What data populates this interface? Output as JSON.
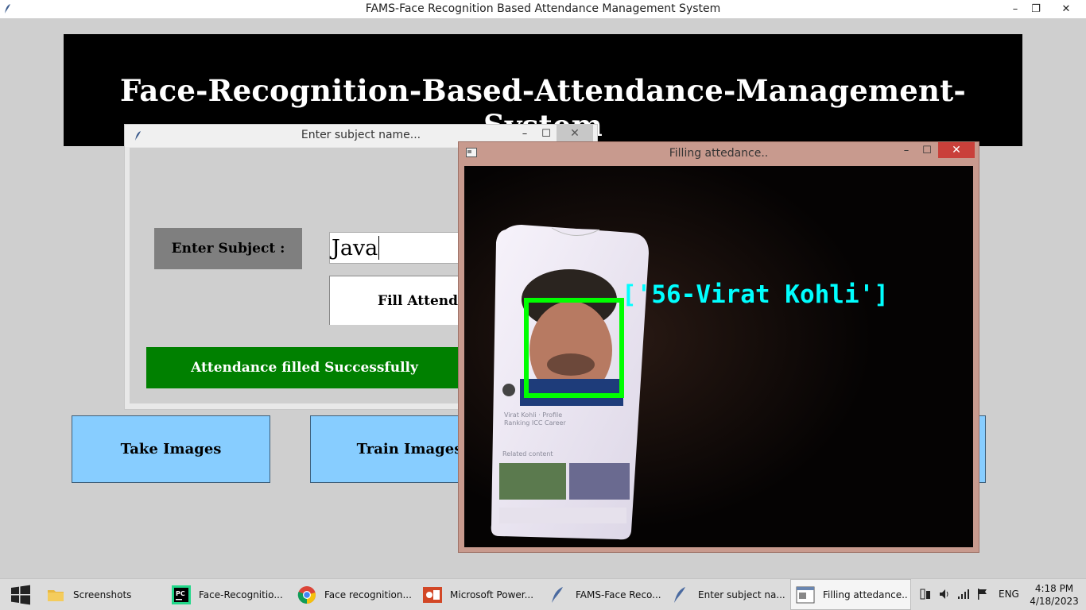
{
  "main_window": {
    "title": "FAMS-Face Recognition Based Attendance Management System",
    "header_title": "Face-Recognition-Based-Attendance-Management-System",
    "buttons": {
      "take_images": "Take Images",
      "train_images": "Train Images"
    },
    "controls": {
      "minimize": "–",
      "restore": "❐",
      "close": "✕"
    }
  },
  "subject_dialog": {
    "title": "Enter subject name...",
    "label": "Enter Subject :",
    "input_value": "Java",
    "fill_button": "Fill Attenda",
    "status": "Attendance filled Successfully",
    "controls": {
      "minimize": "–",
      "maximize": "☐",
      "close": "✕"
    }
  },
  "attendance_window": {
    "title": "Filling attedance..",
    "recognized_label": "['56-Virat Kohli']",
    "phone_text": {
      "line1": "Virat Kohli · Profile",
      "line2": "Ranking  ICC  Career",
      "related": "Related content"
    },
    "controls": {
      "minimize": "–",
      "maximize": "☐",
      "close": "✕"
    }
  },
  "taskbar": {
    "items": [
      {
        "label": "Screenshots",
        "icon": "folder-icon"
      },
      {
        "label": "Face-Recognitio...",
        "icon": "pycharm-icon"
      },
      {
        "label": "Face recognition...",
        "icon": "chrome-icon"
      },
      {
        "label": "Microsoft Power...",
        "icon": "powerpoint-icon"
      },
      {
        "label": "FAMS-Face Reco...",
        "icon": "feather-icon"
      },
      {
        "label": "Enter subject na...",
        "icon": "feather-icon"
      },
      {
        "label": "Filling attedance..",
        "icon": "window-icon"
      }
    ],
    "language": "ENG",
    "time": "4:18 PM",
    "date": "4/18/2023"
  },
  "colors": {
    "banner": "#000000",
    "button_blue": "#87cdff",
    "success_green": "#008000",
    "face_box": "#00ff00",
    "label_cyan": "#00ffff"
  }
}
